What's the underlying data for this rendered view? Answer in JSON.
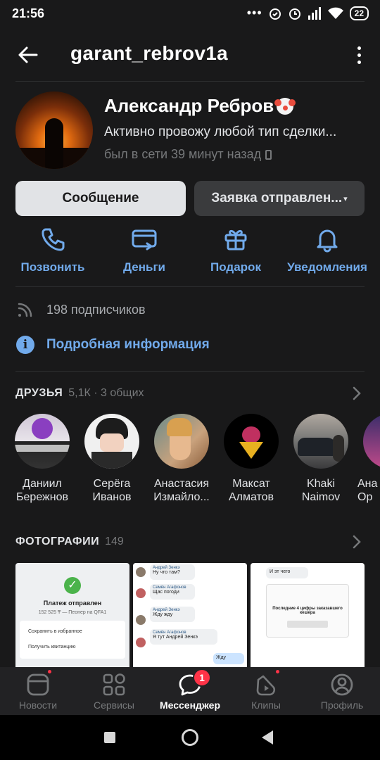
{
  "status_bar": {
    "time": "21:56",
    "battery": "22"
  },
  "app_bar": {
    "title": "garant_rebrov1a"
  },
  "profile": {
    "name": "Александр Ребров",
    "status": "Активно провожу  любой тип сделки...",
    "online": "был в сети 39 минут назад"
  },
  "buttons": {
    "message": "Сообщение",
    "request": "Заявка отправлен..."
  },
  "actions": [
    {
      "label": "Позвонить",
      "icon": "phone-icon"
    },
    {
      "label": "Деньги",
      "icon": "money-card-icon"
    },
    {
      "label": "Подарок",
      "icon": "gift-icon"
    },
    {
      "label": "Уведомления",
      "icon": "bell-icon"
    }
  ],
  "info": {
    "subscribers": "198 подписчиков",
    "more": "Подробная информация"
  },
  "friends": {
    "title": "ДРУЗЬЯ",
    "meta": "5,1К · 3 общих",
    "items": [
      {
        "first": "Даниил",
        "last": "Бережнов"
      },
      {
        "first": "Серёга",
        "last": "Иванов"
      },
      {
        "first": "Анастасия",
        "last": "Измайло..."
      },
      {
        "first": "Максат",
        "last": "Алматов"
      },
      {
        "first": "Khaki",
        "last": "Naimov"
      },
      {
        "first": "Ана",
        "last": "Ор"
      }
    ]
  },
  "photos": {
    "title": "ФОТОГРАФИИ",
    "count": "149",
    "p1": {
      "title": "Платеж отправлен",
      "sub": "152 525 ₸ — Пеонер на QFA1",
      "row1": "Сохранить в избранное",
      "row2": "Получить квитанцию"
    },
    "p2": {
      "m1_name": "Андрей Зенкэ",
      "m1_text": "Ну что там?",
      "m1_time": "14:23",
      "m2_name": "Семён Агафонов",
      "m2_text": "Щас погоди",
      "m2_time": "14:23",
      "m3_name": "Андрей Зенкэ",
      "m3_text": "Жду жду",
      "m3_time": "14:24",
      "m4_name": "Семён Агафонов",
      "m4_text": "Я тут Андрей Зенкэ",
      "m4_time": "14:24",
      "m5_text": "Жду",
      "m5_time": "14:25"
    },
    "p3": {
      "top": "И эт чего",
      "top_time": "14:23",
      "caption": "Последние 4 цифры заказавшего кешера"
    }
  },
  "tabs": [
    {
      "label": "Новости"
    },
    {
      "label": "Сервисы"
    },
    {
      "label": "Мессенджер",
      "badge": "1"
    },
    {
      "label": "Клипы"
    },
    {
      "label": "Профиль"
    }
  ]
}
